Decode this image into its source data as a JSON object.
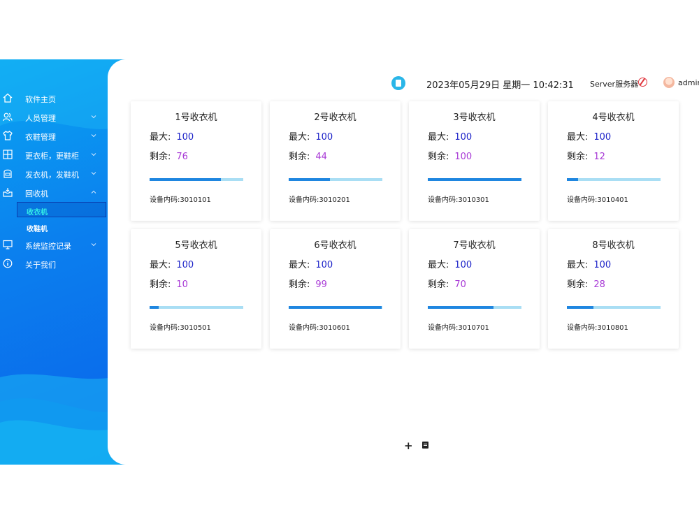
{
  "sidebar": {
    "items": [
      {
        "label": "软件主页",
        "icon": "home-icon",
        "has_chevron": false
      },
      {
        "label": "人员管理",
        "icon": "users-icon",
        "has_chevron": true
      },
      {
        "label": "衣鞋管理",
        "icon": "shirt-icon",
        "has_chevron": true
      },
      {
        "label": "更衣柜，更鞋柜",
        "icon": "cabinet-icon",
        "has_chevron": true
      },
      {
        "label": "发衣机，发鞋机",
        "icon": "dispenser-icon",
        "has_chevron": true
      },
      {
        "label": "回收机",
        "icon": "inbox-icon",
        "has_chevron": true,
        "expanded": true
      },
      {
        "label": "收衣机",
        "sub": true,
        "active": true
      },
      {
        "label": "收鞋机",
        "sub": true
      },
      {
        "label": "系统监控记录",
        "icon": "monitor-icon",
        "has_chevron": true
      },
      {
        "label": "关于我们",
        "icon": "info-icon",
        "has_chevron": false
      }
    ]
  },
  "header": {
    "datetime": "2023年05月29日 星期一 10:42:31",
    "server_label": "Server服务器",
    "user": "admin"
  },
  "labels": {
    "max": "最大:",
    "remaining": "剩余:",
    "code_prefix": "设备内码:"
  },
  "cards": [
    {
      "title": "1号收衣机",
      "max": "100",
      "remaining": "76",
      "fill": 0.76,
      "code": "设备内码:3010101"
    },
    {
      "title": "2号收衣机",
      "max": "100",
      "remaining": "44",
      "fill": 0.44,
      "code": "设备内码:3010201"
    },
    {
      "title": "3号收衣机",
      "max": "100",
      "remaining": "100",
      "fill": 1.0,
      "code": "设备内码:3010301"
    },
    {
      "title": "4号收衣机",
      "max": "100",
      "remaining": "12",
      "fill": 0.12,
      "code": "设备内码:3010401"
    },
    {
      "title": "5号收衣机",
      "max": "100",
      "remaining": "10",
      "fill": 0.1,
      "code": "设备内码:3010501"
    },
    {
      "title": "6号收衣机",
      "max": "100",
      "remaining": "99",
      "fill": 0.99,
      "code": "设备内码:3010601"
    },
    {
      "title": "7号收衣机",
      "max": "100",
      "remaining": "70",
      "fill": 0.7,
      "code": "设备内码:3010701"
    },
    {
      "title": "8号收衣机",
      "max": "100",
      "remaining": "28",
      "fill": 0.28,
      "code": "设备内码:3010801"
    }
  ],
  "footer": {
    "add_symbol": "+",
    "icons": [
      "add-icon",
      "book-icon"
    ]
  },
  "colors": {
    "accent": "#1f86e0",
    "max_value": "#1c22c8",
    "remaining_value": "#a83ad6",
    "active_sub": "#34f0e6"
  }
}
